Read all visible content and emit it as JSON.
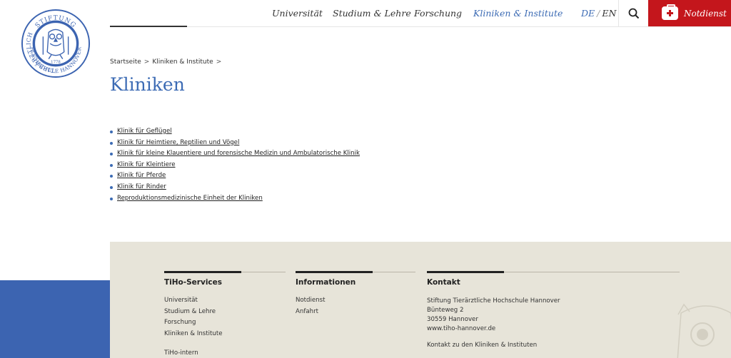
{
  "logo": {
    "ring_text_top": "STIFTUNG",
    "ring_text_left": "TIERÄRZTLICHE",
    "ring_text_bottom": "HOCHSCHULE HANNOVER",
    "year": "1778",
    "colors": {
      "ring": "#3c64b1",
      "inner": "#ffffff"
    }
  },
  "nav": {
    "items": [
      {
        "label": "Universität"
      },
      {
        "label": "Studium & Lehre"
      },
      {
        "label": "Forschung"
      },
      {
        "label": "Kliniken & Institute",
        "active": true
      }
    ],
    "lang_de": "DE",
    "lang_sep": "/",
    "lang_en": "EN",
    "search_icon": "search-icon",
    "emergency_label": "Notdienst",
    "emergency_icon": "first-aid-kit-icon",
    "colors": {
      "accent": "#3c6bb4",
      "emergency": "#c4161c"
    }
  },
  "breadcrumb": {
    "items": [
      "Startseite",
      "Kliniken & Institute"
    ],
    "separator": ">"
  },
  "page": {
    "title": "Kliniken",
    "links": [
      "Klinik für Geflügel",
      "Klinik für Heimtiere, Reptilien und Vögel",
      "Klinik für kleine Klauentiere und forensische Medizin und Ambulatorische Klinik",
      "Klinik für Kleintiere",
      "Klinik für Pferde",
      "Klinik für Rinder",
      "Reproduktionsmedizinische Einheit der Kliniken"
    ]
  },
  "footer": {
    "services": {
      "heading": "TiHo-Services",
      "items": [
        "Universität",
        "Studium & Lehre",
        "Forschung",
        "Kliniken & Institute"
      ],
      "more": "TiHo-intern"
    },
    "info": {
      "heading": "Informationen",
      "items": [
        "Notdienst",
        "Anfahrt"
      ]
    },
    "contact": {
      "heading": "Kontakt",
      "address": [
        "Stiftung Tierärztliche Hochschule Hannover",
        "Bünteweg 2",
        "30559 Hannover",
        "www.tiho-hannover.de"
      ],
      "link": "Kontakt zu den Kliniken & Instituten"
    },
    "colors": {
      "background": "#e7e4d9",
      "blue_block": "#3c64b1"
    }
  }
}
